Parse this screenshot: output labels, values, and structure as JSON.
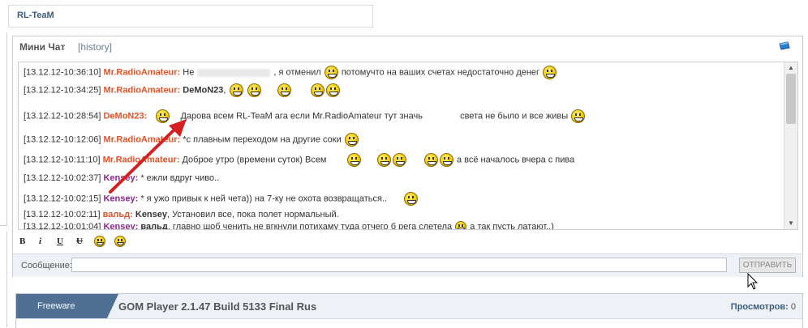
{
  "top_bar": {
    "title": "RL-TeaM"
  },
  "chat": {
    "title": "Мини Чат",
    "history_label": "[history]",
    "messages": [
      {
        "ts": "[13.12.12-10:36:10]",
        "nick": "Mr.RadioAmateur:",
        "t1": "Не",
        "t2": ", я отменил",
        "t3": "потомучто на ваших счетах недостаточно денег"
      },
      {
        "ts": "[13.12.12-10:34:25]",
        "nick": "Mr.RadioAmateur:",
        "ref": "DeMoN23",
        "t1": ","
      },
      {
        "ts": "[13.12.12-10:28:54]",
        "nick": "DeMoN23:",
        "t1": "Дарова всем RL-TeaM ага если Mr.RadioAmateur тут значь",
        "t2": "света не было и все живы"
      },
      {
        "ts": "[13.12.12-10:12:06]",
        "nick": "Mr.RadioAmateur:",
        "t1": "*с плавным переходом на другие соки"
      },
      {
        "ts": "[13.12.12-10:11:10]",
        "nick": "Mr.RadioAmateur:",
        "t1": "Доброе утро (времени суток) Всем",
        "t2": "а всё началось вчера с пива"
      },
      {
        "ts": "[13.12.12-10:02:37]",
        "nick": "Kensey:",
        "t1": "* ежли вдруг чиво.."
      },
      {
        "ts": "[13.12.12-10:02:15]",
        "nick": "Kensey:",
        "t1": "* я ужо привык к ней чета)) на 7-ку не охота возвращаться.."
      },
      {
        "ts": "[13.12.12-10:02:11]",
        "nick": "вальд:",
        "ref": "Kensey",
        "t1": ", Установил все, пока полет нормальный."
      },
      {
        "ts": "[13.12.12-10:01:04]",
        "nick": "Kensey:",
        "ref": "вальд",
        "t1": ", главно шоб ченить не вгкнули потихаму туда отчего б рега слетела",
        "t2": "а так пусть латают..)"
      }
    ],
    "toolbar": {
      "bold": "B",
      "italic": "i",
      "underline": "U",
      "strike": "U"
    },
    "message_label": "Сообщение:",
    "message_value": "",
    "send_label": "ОТПРАВИТЬ"
  },
  "bottom": {
    "tab_label": "Freeware",
    "title": "GOM Player 2.1.47 Build 5133 Final Rus",
    "views_label": "Просмотров:",
    "views_count": "0"
  }
}
